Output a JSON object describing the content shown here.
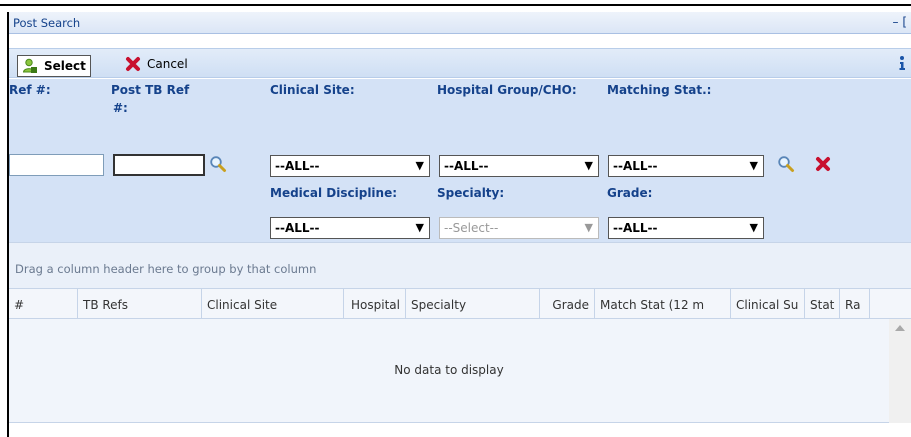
{
  "window": {
    "title": "Post Search",
    "minimize_glyph": "– ["
  },
  "toolbar": {
    "select_label": "Select",
    "cancel_label": "Cancel",
    "select_icon": "user-select-icon",
    "cancel_icon": "red-x-icon",
    "info_icon": "info-icon"
  },
  "filters": {
    "ref_label": "Ref #:",
    "post_tb_ref_label_1": "Post TB Ref",
    "post_tb_ref_label_2": "#:",
    "clinical_site_label": "Clinical Site:",
    "hospital_group_label": "Hospital Group/CHO:",
    "matching_stat_label": "Matching Stat.:",
    "medical_discipline_label": "Medical Discipline:",
    "specialty_label": "Specialty:",
    "grade_label": "Grade:",
    "ref_value": "",
    "post_tb_ref_value": "",
    "clinical_site_value": "--ALL--",
    "hospital_group_value": "--ALL--",
    "matching_stat_value": "--ALL--",
    "medical_discipline_value": "--ALL--",
    "specialty_value": "--Select--",
    "grade_value": "--ALL--"
  },
  "grid": {
    "group_hint": "Drag a column header here to group by that column",
    "columns": [
      "#",
      "TB Refs",
      "Clinical Site",
      "Hospital",
      "Specialty",
      "Grade",
      "Match Stat (12 m",
      "Clinical Su",
      "Stat",
      "Ra"
    ],
    "empty_text": "No data to display"
  },
  "colors": {
    "panel": "#d4e2f6",
    "label": "#15428b",
    "toolbar": "#cfdff4"
  }
}
